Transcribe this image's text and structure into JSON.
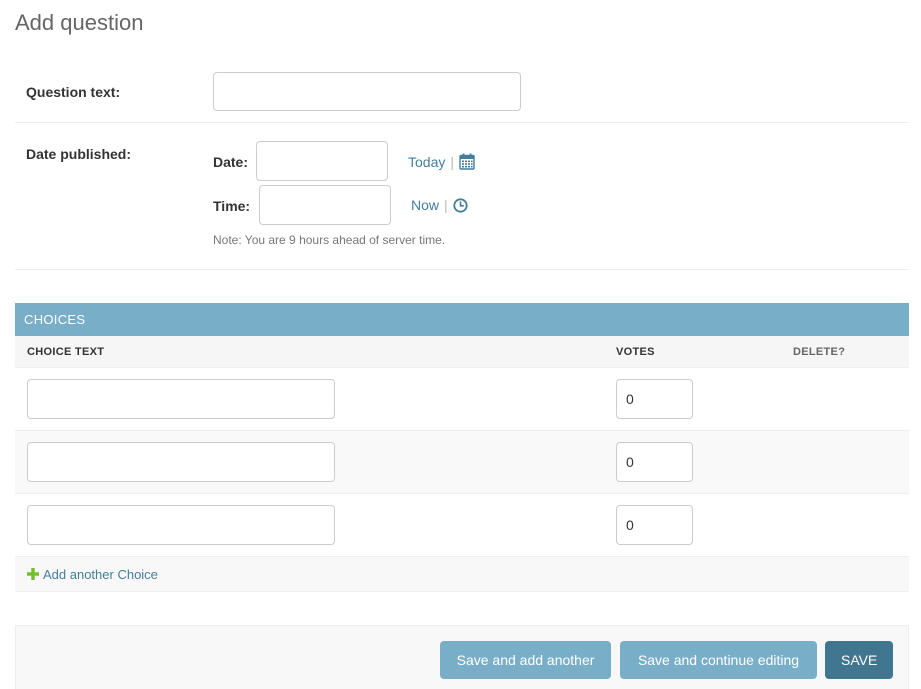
{
  "page": {
    "title": "Add question"
  },
  "question_field": {
    "label": "Question text:",
    "value": ""
  },
  "date_field": {
    "label": "Date published:",
    "date_label": "Date:",
    "date_value": "",
    "today_link": "Today",
    "calendar_icon": "calendar-icon",
    "time_label": "Time:",
    "time_value": "",
    "now_link": "Now",
    "clock_icon": "clock-icon",
    "separator": "|",
    "help_note": "Note: You are 9 hours ahead of server time."
  },
  "inline": {
    "title": "Choices",
    "columns": {
      "choice_text": "CHOICE TEXT",
      "votes": "VOTES",
      "delete": "DELETE?"
    },
    "rows": [
      {
        "choice_text": "",
        "votes": "0"
      },
      {
        "choice_text": "",
        "votes": "0"
      },
      {
        "choice_text": "",
        "votes": "0"
      }
    ],
    "add_link": "Add another Choice"
  },
  "submit": {
    "save_add_another": "Save and add another",
    "save_continue": "Save and continue editing",
    "save": "SAVE"
  },
  "colors": {
    "header": "#79aec8",
    "primary_button": "#417690",
    "link": "#447e9b",
    "add_icon": "#70bf2b"
  }
}
